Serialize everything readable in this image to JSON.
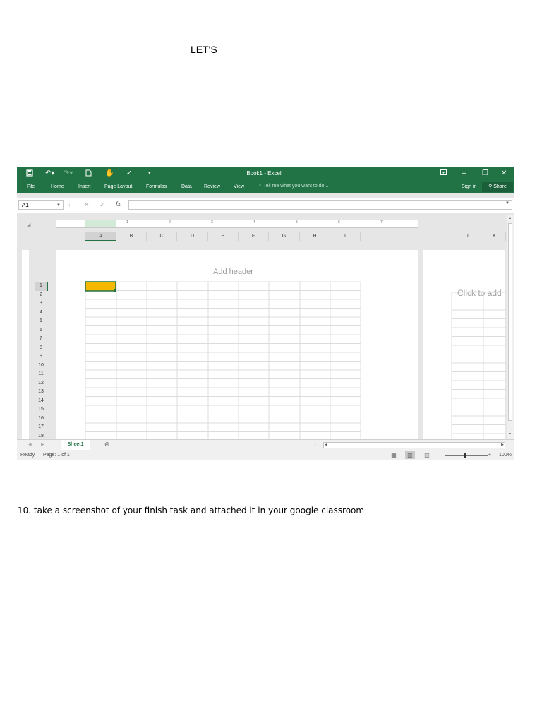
{
  "heading": "LET'S",
  "instruction": "10. take a screenshot of your finish task and attached it in your google classroom",
  "excel": {
    "title": "Book1 - Excel",
    "quick_access": {
      "save_icon": "save-icon",
      "undo_icon": "undo-icon",
      "redo_icon": "redo-icon",
      "new_icon": "new-document-icon",
      "touch_mode_icon": "touch-mode-icon",
      "spelling_icon": "spelling-icon",
      "customize_icon": "customize-toolbar-icon"
    },
    "window_controls": {
      "ribbon_display_icon": "ribbon-display-icon",
      "minimize_icon": "minimize-icon",
      "restore_icon": "restore-icon",
      "close_icon": "close-icon"
    },
    "tabs": [
      "File",
      "Home",
      "Insert",
      "Page Layout",
      "Formulas",
      "Data",
      "Review",
      "View"
    ],
    "tell_me": "Tell me what you want to do...",
    "sign_in": "Sign in",
    "share": "Share",
    "name_box": "A1",
    "fx_label": "fx",
    "ruler_numbers": [
      "1",
      "2",
      "3",
      "4",
      "5",
      "6",
      "7"
    ],
    "columns": [
      "A",
      "B",
      "C",
      "D",
      "E",
      "F",
      "G",
      "H",
      "I"
    ],
    "columns_page2": [
      "J",
      "K"
    ],
    "selected_cell": "A1",
    "add_header": "Add header",
    "click_to_add": "Click to add",
    "rows": [
      "1",
      "2",
      "3",
      "4",
      "5",
      "6",
      "7",
      "8",
      "9",
      "10",
      "11",
      "12",
      "13",
      "14",
      "15",
      "16",
      "17",
      "18"
    ],
    "sheet_tab": "Sheet1",
    "status": "Ready",
    "page_info": "Page: 1 of 1",
    "zoom": "100%",
    "colors": {
      "accent": "#217346",
      "selection": "#f5b800"
    }
  }
}
